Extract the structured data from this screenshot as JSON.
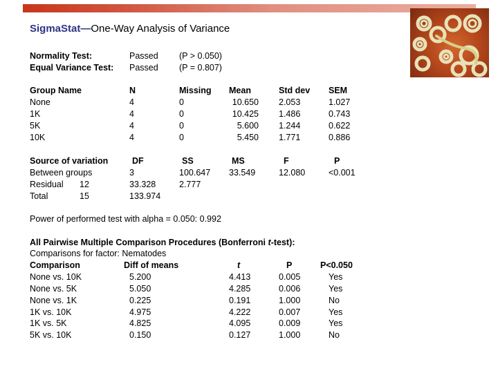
{
  "header": {
    "brand": "SigmaStat",
    "dash": "—",
    "title": "One-Way Analysis of Variance",
    "accent_color": "#c8361a",
    "title_color": "#2e3383",
    "image": "nematodes-photo"
  },
  "tests": [
    {
      "label": "Normality Test:",
      "result": "Passed",
      "p": "(P > 0.050)"
    },
    {
      "label": "Equal Variance Test:",
      "result": "Passed",
      "p": "(P = 0.807)"
    }
  ],
  "groups": {
    "headers": [
      "Group Name",
      "N",
      "Missing",
      "Mean",
      "Std dev",
      "SEM"
    ],
    "rows": [
      [
        "None",
        "4",
        "0",
        "10.650",
        "2.053",
        "1.027"
      ],
      [
        "1K",
        "4",
        "0",
        "10.425",
        "1.486",
        "0.743"
      ],
      [
        "5K",
        "4",
        "0",
        "5.600",
        "1.244",
        "0.622"
      ],
      [
        "10K",
        "4",
        "0",
        "5.450",
        "1.771",
        "0.886"
      ]
    ]
  },
  "anova": {
    "headers": [
      "Source of variation",
      "DF",
      "SS",
      "MS",
      "F",
      "P"
    ],
    "rows": [
      {
        "source": "Between groups",
        "df": "3",
        "ss": "100.647",
        "ms": "33.549",
        "f": "12.080",
        "p": "<0.001"
      },
      {
        "source": "Residual",
        "df": "12",
        "ss": "33.328",
        "ms": "2.777"
      },
      {
        "source": "Total",
        "df": "15",
        "ss": "133.974"
      }
    ]
  },
  "power": "Power of performed test with alpha = 0.050: 0.992",
  "pairwise": {
    "title_pre": "All Pairwise Multiple Comparison Procedures (Bonferroni ",
    "title_t": "t",
    "title_post": "-test):",
    "subtitle": "Comparisons for factor: Nematodes",
    "headers": [
      "Comparison",
      "Diff of means",
      "t",
      "P",
      "P<0.050"
    ],
    "rows": [
      [
        "None vs. 10K",
        "5.200",
        "4.413",
        "0.005",
        "Yes"
      ],
      [
        "None vs. 5K",
        "5.050",
        "4.285",
        "0.006",
        "Yes"
      ],
      [
        "None vs. 1K",
        "0.225",
        "0.191",
        "1.000",
        "No"
      ],
      [
        "1K vs. 10K",
        "4.975",
        "4.222",
        "0.007",
        "Yes"
      ],
      [
        "1K vs. 5K",
        "4.825",
        "4.095",
        "0.009",
        "Yes"
      ],
      [
        "5K vs. 10K",
        "0.150",
        "0.127",
        "1.000",
        "No"
      ]
    ]
  }
}
